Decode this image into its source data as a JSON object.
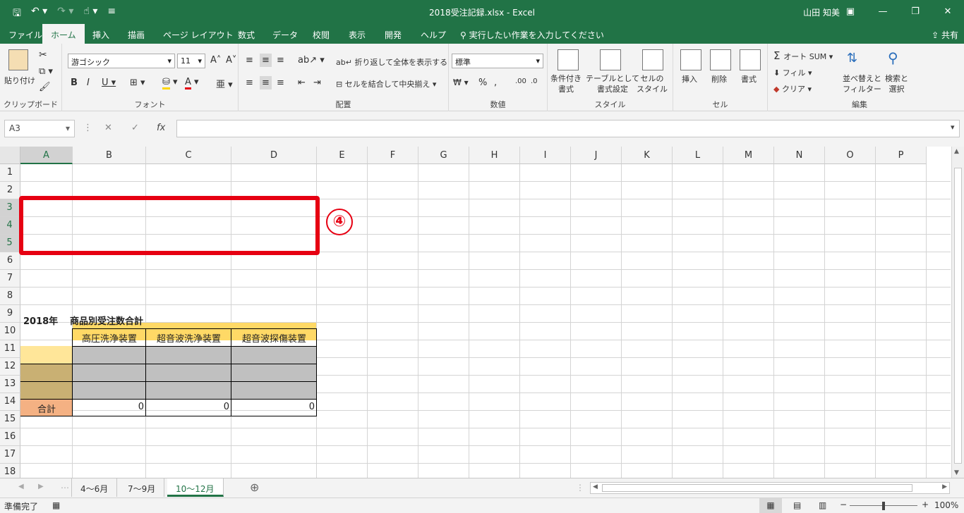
{
  "window": {
    "title": "2018受注記録.xlsx  -  Excel",
    "user": "山田 知美"
  },
  "menu": {
    "tabs": [
      "ファイル",
      "ホーム",
      "挿入",
      "描画",
      "ページ レイアウト",
      "数式",
      "データ",
      "校閲",
      "表示",
      "開発",
      "ヘルプ"
    ],
    "active_tab": "ホーム",
    "search": "実行したい作業を入力してください",
    "share": "共有"
  },
  "ribbon": {
    "clipboard": {
      "paste": "貼り付け",
      "group": "クリップボード"
    },
    "font": {
      "name": "游ゴシック",
      "size": "11",
      "group": "フォント"
    },
    "alignment": {
      "wrap": "折り返して全体を表示する",
      "merge": "セルを結合して中央揃え",
      "group": "配置"
    },
    "number": {
      "format": "標準",
      "group": "数値"
    },
    "styles": {
      "cond": "条件付き\n書式",
      "table": "テーブルとして\n書式設定",
      "cell": "セルの\nスタイル",
      "group": "スタイル"
    },
    "cells": {
      "insert": "挿入",
      "delete": "削除",
      "format": "書式",
      "group": "セル"
    },
    "editing": {
      "autosum": "オート SUM",
      "fill": "フィル",
      "clear": "クリア",
      "sort": "並べ替えと\nフィルター",
      "find": "検索と\n選択",
      "group": "編集"
    }
  },
  "formula_bar": {
    "name_box": "A3",
    "formula": ""
  },
  "grid": {
    "columns": [
      "A",
      "B",
      "C",
      "D",
      "E",
      "F",
      "G",
      "H",
      "I",
      "J",
      "K",
      "L",
      "M",
      "N",
      "O",
      "P"
    ],
    "rows": [
      "1",
      "2",
      "3",
      "4",
      "5",
      "6",
      "7",
      "8",
      "9",
      "10",
      "11",
      "12",
      "13",
      "14",
      "15",
      "16",
      "17",
      "18"
    ],
    "selected_column": "A",
    "selected_rows": [
      "3",
      "4",
      "5"
    ],
    "cells": {
      "a1": "2018年",
      "b1": "商品別受注数合計",
      "b2": "高圧洗浄装置",
      "c2": "超音波洗浄装置",
      "d2": "超音波探傷装置",
      "a6": "合計",
      "b6": "0",
      "c6": "0",
      "d6": "0"
    },
    "annotation": "④"
  },
  "sheets": {
    "tabs": [
      "4～6月",
      "7～9月",
      "10～12月"
    ],
    "active": "10～12月"
  },
  "status": {
    "text": "準備完了",
    "zoom": "100%"
  },
  "colors": {
    "accent": "#217346",
    "header_fill": "#ffd966",
    "gray_fill": "#c0c0c0",
    "khaki_fill": "#c9b073",
    "total_fill": "#f4b183",
    "annotation": "#e60012"
  }
}
